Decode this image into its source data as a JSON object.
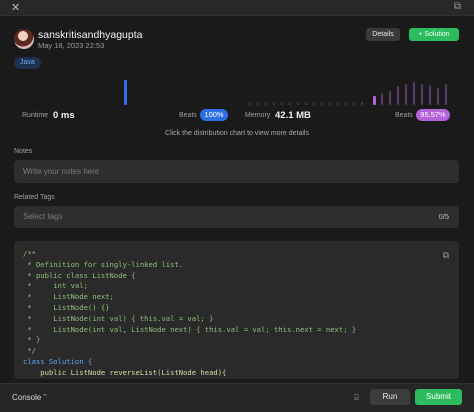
{
  "user": {
    "name": "sanskritisandhyagupta",
    "date": "May 18, 2023 22:53"
  },
  "header": {
    "details_label": "Details",
    "solution_label": "Solution",
    "solution_icon": "plus-icon"
  },
  "language": "Java",
  "stats": {
    "runtime": {
      "label": "Runtime",
      "value": "0 ms",
      "beats_label": "Beats",
      "beats_value": "100%"
    },
    "memory": {
      "label": "Memory",
      "value": "42.1 MB",
      "beats_label": "Beats",
      "beats_value": "95.57%"
    }
  },
  "chart_hint": "Click the distribution chart to view more details",
  "notes": {
    "label": "Notes",
    "placeholder": "Write your notes here"
  },
  "tags": {
    "label": "Related Tags",
    "placeholder": "Select tags",
    "count": "0/5"
  },
  "code_lines": [
    "/**",
    " * Definition for singly-linked list.",
    " * public class ListNode {",
    " *     int val;",
    " *     ListNode next;",
    " *     ListNode() {}",
    " *     ListNode(int val) { this.val = val; }",
    " *     ListNode(int val, ListNode next) { this.val = val; this.next = next; }",
    " * }",
    " */",
    "class Solution {",
    "    public ListNode reverseList(ListNode head){"
  ],
  "bottom": {
    "console_label": "Console",
    "run_label": "Run",
    "submit_label": "Submit"
  },
  "colors": {
    "accent_green": "#2cbb5d",
    "runtime_blue": "#2f6fe4",
    "memory_purple": "#b362d9"
  }
}
